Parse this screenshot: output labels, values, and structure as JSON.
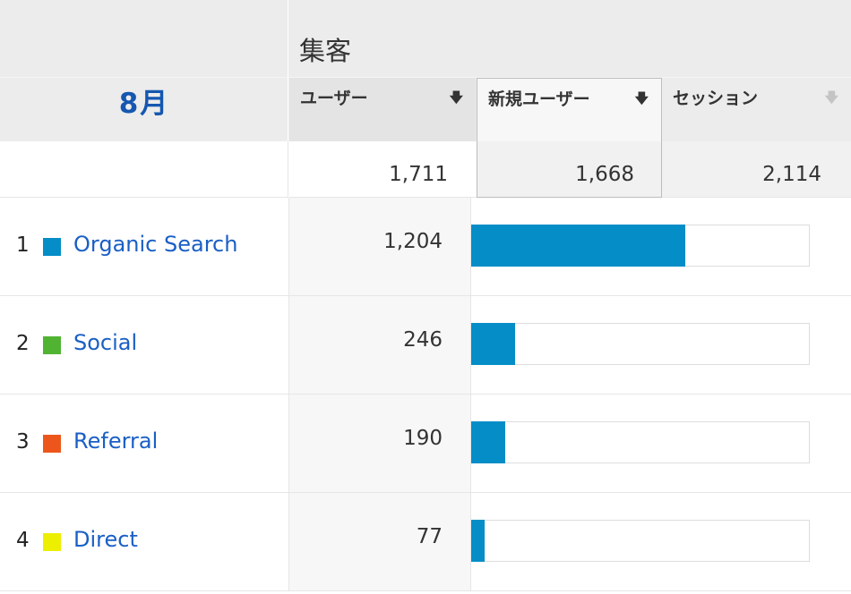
{
  "header": {
    "group_title": "集客",
    "month_label": "8月"
  },
  "columns": [
    {
      "label": "ユーザー",
      "sort_icon": "arrow-down-icon"
    },
    {
      "label": "新規ユーザー",
      "sort_icon": "arrow-down-icon"
    },
    {
      "label": "セッション",
      "sort_icon": "arrow-down-icon"
    }
  ],
  "totals": {
    "users": "1,711",
    "new_users": "1,668",
    "sessions": "2,114"
  },
  "rows": [
    {
      "rank": "1",
      "channel": "Organic Search",
      "color": "#058dc7",
      "users": "1,204",
      "share": 0.7037
    },
    {
      "rank": "2",
      "channel": "Social",
      "color": "#50b432",
      "users": "246",
      "share": 0.1438
    },
    {
      "rank": "3",
      "channel": "Referral",
      "color": "#ed561b",
      "users": "190",
      "share": 0.111
    },
    {
      "rank": "4",
      "channel": "Direct",
      "color": "#edef00",
      "users": "77",
      "share": 0.045
    }
  ],
  "colors": {
    "bar": "#058dc7",
    "link": "#1a5fc5",
    "month": "#1557b0"
  }
}
